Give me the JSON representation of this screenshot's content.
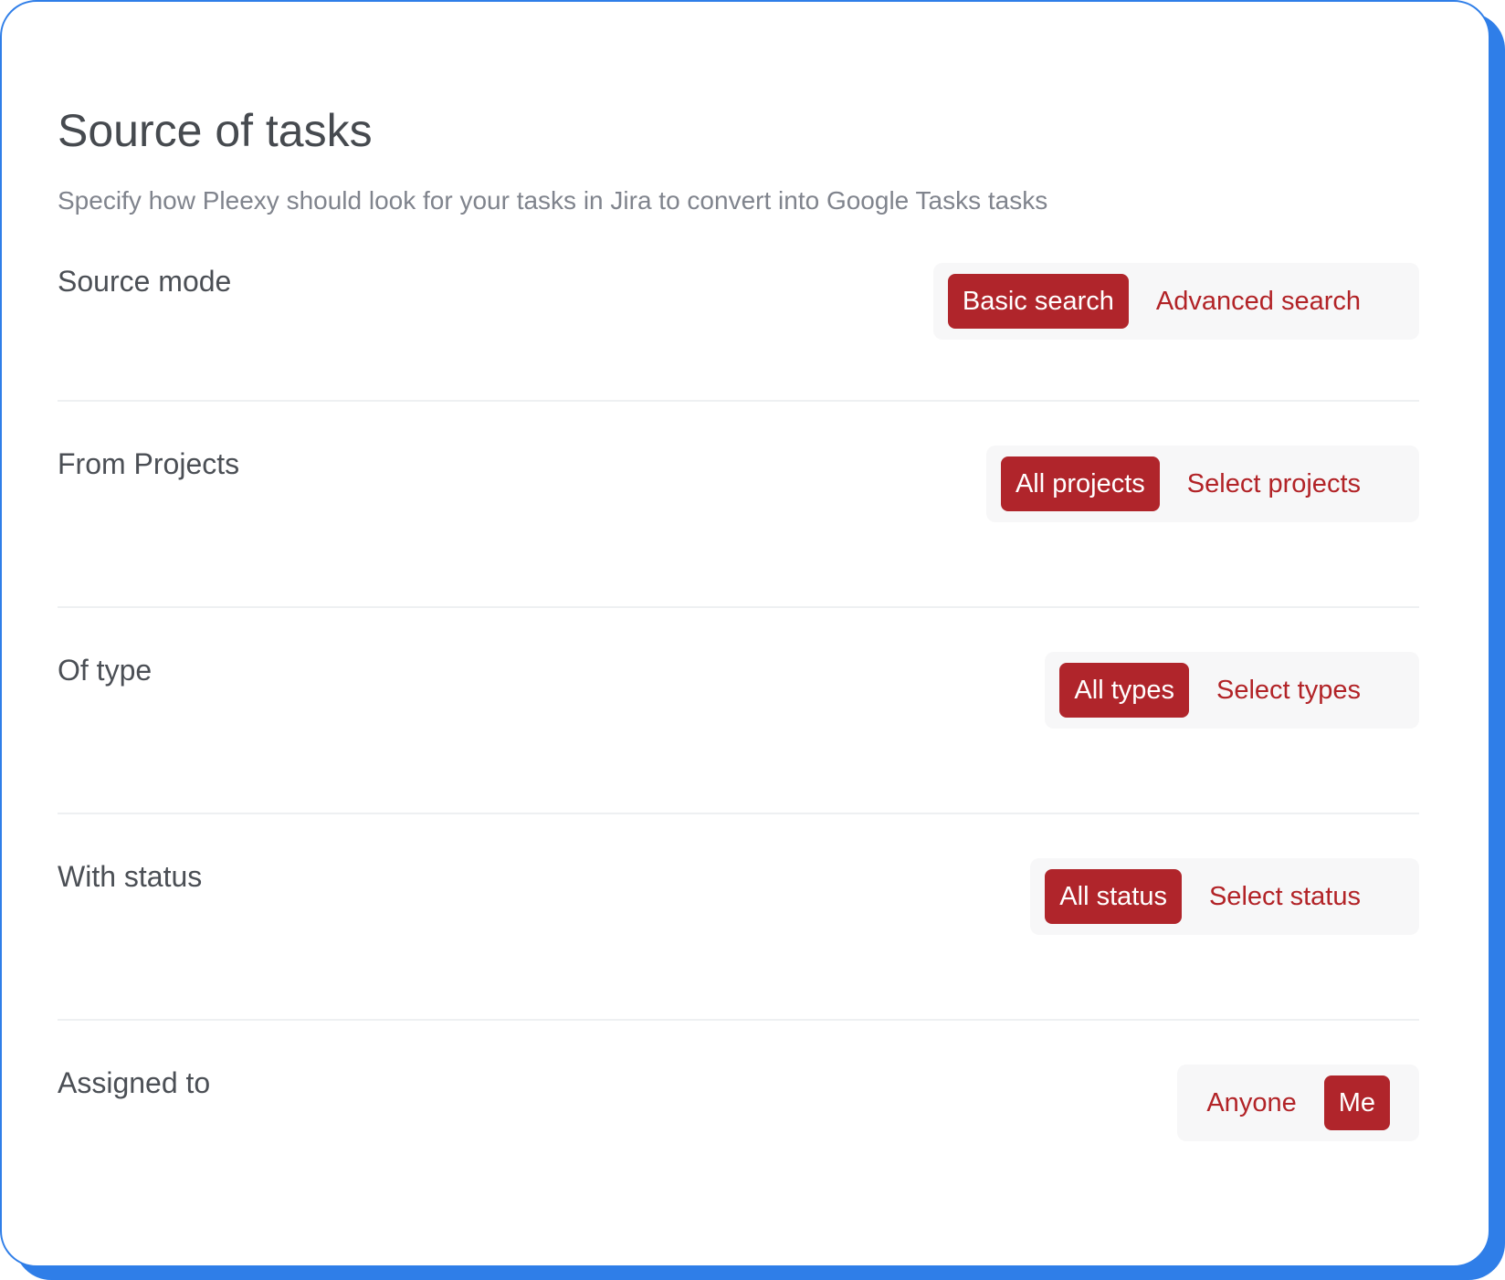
{
  "header": {
    "title": "Source of tasks",
    "subtitle": "Specify how Pleexy should look for your tasks in Jira to convert into Google Tasks tasks"
  },
  "colors": {
    "accent": "#b0252b",
    "frame": "#2f7ee8"
  },
  "rows": [
    {
      "label": "Source mode",
      "options": [
        {
          "label": "Basic search",
          "active": true
        },
        {
          "label": "Advanced search",
          "active": false
        }
      ]
    },
    {
      "label": "From Projects",
      "options": [
        {
          "label": "All projects",
          "active": true
        },
        {
          "label": "Select projects",
          "active": false
        }
      ]
    },
    {
      "label": "Of type",
      "options": [
        {
          "label": "All types",
          "active": true
        },
        {
          "label": "Select types",
          "active": false
        }
      ]
    },
    {
      "label": "With status",
      "options": [
        {
          "label": "All status",
          "active": true
        },
        {
          "label": "Select status",
          "active": false
        }
      ]
    },
    {
      "label": "Assigned to",
      "options": [
        {
          "label": "Anyone",
          "active": false
        },
        {
          "label": "Me",
          "active": true
        }
      ]
    }
  ]
}
